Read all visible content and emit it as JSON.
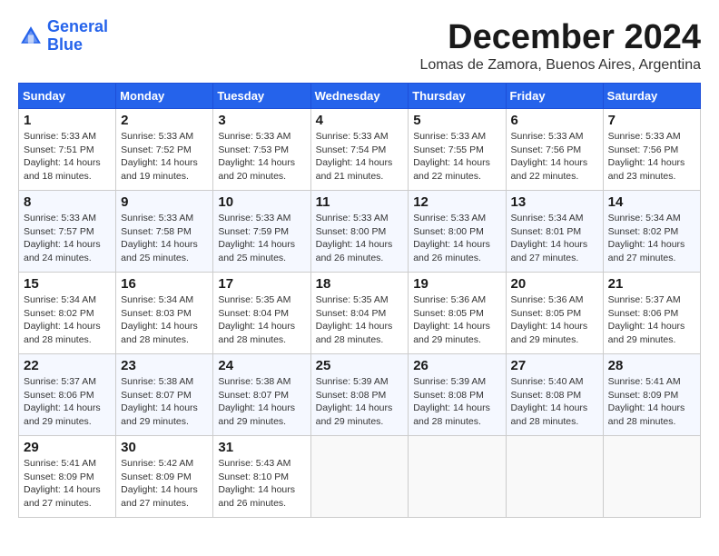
{
  "logo": {
    "line1": "General",
    "line2": "Blue"
  },
  "title": "December 2024",
  "subtitle": "Lomas de Zamora, Buenos Aires, Argentina",
  "days_of_week": [
    "Sunday",
    "Monday",
    "Tuesday",
    "Wednesday",
    "Thursday",
    "Friday",
    "Saturday"
  ],
  "weeks": [
    [
      {
        "day": "1",
        "sunrise": "Sunrise: 5:33 AM",
        "sunset": "Sunset: 7:51 PM",
        "daylight": "Daylight: 14 hours and 18 minutes."
      },
      {
        "day": "2",
        "sunrise": "Sunrise: 5:33 AM",
        "sunset": "Sunset: 7:52 PM",
        "daylight": "Daylight: 14 hours and 19 minutes."
      },
      {
        "day": "3",
        "sunrise": "Sunrise: 5:33 AM",
        "sunset": "Sunset: 7:53 PM",
        "daylight": "Daylight: 14 hours and 20 minutes."
      },
      {
        "day": "4",
        "sunrise": "Sunrise: 5:33 AM",
        "sunset": "Sunset: 7:54 PM",
        "daylight": "Daylight: 14 hours and 21 minutes."
      },
      {
        "day": "5",
        "sunrise": "Sunrise: 5:33 AM",
        "sunset": "Sunset: 7:55 PM",
        "daylight": "Daylight: 14 hours and 22 minutes."
      },
      {
        "day": "6",
        "sunrise": "Sunrise: 5:33 AM",
        "sunset": "Sunset: 7:56 PM",
        "daylight": "Daylight: 14 hours and 22 minutes."
      },
      {
        "day": "7",
        "sunrise": "Sunrise: 5:33 AM",
        "sunset": "Sunset: 7:56 PM",
        "daylight": "Daylight: 14 hours and 23 minutes."
      }
    ],
    [
      {
        "day": "8",
        "sunrise": "Sunrise: 5:33 AM",
        "sunset": "Sunset: 7:57 PM",
        "daylight": "Daylight: 14 hours and 24 minutes."
      },
      {
        "day": "9",
        "sunrise": "Sunrise: 5:33 AM",
        "sunset": "Sunset: 7:58 PM",
        "daylight": "Daylight: 14 hours and 25 minutes."
      },
      {
        "day": "10",
        "sunrise": "Sunrise: 5:33 AM",
        "sunset": "Sunset: 7:59 PM",
        "daylight": "Daylight: 14 hours and 25 minutes."
      },
      {
        "day": "11",
        "sunrise": "Sunrise: 5:33 AM",
        "sunset": "Sunset: 8:00 PM",
        "daylight": "Daylight: 14 hours and 26 minutes."
      },
      {
        "day": "12",
        "sunrise": "Sunrise: 5:33 AM",
        "sunset": "Sunset: 8:00 PM",
        "daylight": "Daylight: 14 hours and 26 minutes."
      },
      {
        "day": "13",
        "sunrise": "Sunrise: 5:34 AM",
        "sunset": "Sunset: 8:01 PM",
        "daylight": "Daylight: 14 hours and 27 minutes."
      },
      {
        "day": "14",
        "sunrise": "Sunrise: 5:34 AM",
        "sunset": "Sunset: 8:02 PM",
        "daylight": "Daylight: 14 hours and 27 minutes."
      }
    ],
    [
      {
        "day": "15",
        "sunrise": "Sunrise: 5:34 AM",
        "sunset": "Sunset: 8:02 PM",
        "daylight": "Daylight: 14 hours and 28 minutes."
      },
      {
        "day": "16",
        "sunrise": "Sunrise: 5:34 AM",
        "sunset": "Sunset: 8:03 PM",
        "daylight": "Daylight: 14 hours and 28 minutes."
      },
      {
        "day": "17",
        "sunrise": "Sunrise: 5:35 AM",
        "sunset": "Sunset: 8:04 PM",
        "daylight": "Daylight: 14 hours and 28 minutes."
      },
      {
        "day": "18",
        "sunrise": "Sunrise: 5:35 AM",
        "sunset": "Sunset: 8:04 PM",
        "daylight": "Daylight: 14 hours and 28 minutes."
      },
      {
        "day": "19",
        "sunrise": "Sunrise: 5:36 AM",
        "sunset": "Sunset: 8:05 PM",
        "daylight": "Daylight: 14 hours and 29 minutes."
      },
      {
        "day": "20",
        "sunrise": "Sunrise: 5:36 AM",
        "sunset": "Sunset: 8:05 PM",
        "daylight": "Daylight: 14 hours and 29 minutes."
      },
      {
        "day": "21",
        "sunrise": "Sunrise: 5:37 AM",
        "sunset": "Sunset: 8:06 PM",
        "daylight": "Daylight: 14 hours and 29 minutes."
      }
    ],
    [
      {
        "day": "22",
        "sunrise": "Sunrise: 5:37 AM",
        "sunset": "Sunset: 8:06 PM",
        "daylight": "Daylight: 14 hours and 29 minutes."
      },
      {
        "day": "23",
        "sunrise": "Sunrise: 5:38 AM",
        "sunset": "Sunset: 8:07 PM",
        "daylight": "Daylight: 14 hours and 29 minutes."
      },
      {
        "day": "24",
        "sunrise": "Sunrise: 5:38 AM",
        "sunset": "Sunset: 8:07 PM",
        "daylight": "Daylight: 14 hours and 29 minutes."
      },
      {
        "day": "25",
        "sunrise": "Sunrise: 5:39 AM",
        "sunset": "Sunset: 8:08 PM",
        "daylight": "Daylight: 14 hours and 29 minutes."
      },
      {
        "day": "26",
        "sunrise": "Sunrise: 5:39 AM",
        "sunset": "Sunset: 8:08 PM",
        "daylight": "Daylight: 14 hours and 28 minutes."
      },
      {
        "day": "27",
        "sunrise": "Sunrise: 5:40 AM",
        "sunset": "Sunset: 8:08 PM",
        "daylight": "Daylight: 14 hours and 28 minutes."
      },
      {
        "day": "28",
        "sunrise": "Sunrise: 5:41 AM",
        "sunset": "Sunset: 8:09 PM",
        "daylight": "Daylight: 14 hours and 28 minutes."
      }
    ],
    [
      {
        "day": "29",
        "sunrise": "Sunrise: 5:41 AM",
        "sunset": "Sunset: 8:09 PM",
        "daylight": "Daylight: 14 hours and 27 minutes."
      },
      {
        "day": "30",
        "sunrise": "Sunrise: 5:42 AM",
        "sunset": "Sunset: 8:09 PM",
        "daylight": "Daylight: 14 hours and 27 minutes."
      },
      {
        "day": "31",
        "sunrise": "Sunrise: 5:43 AM",
        "sunset": "Sunset: 8:10 PM",
        "daylight": "Daylight: 14 hours and 26 minutes."
      },
      null,
      null,
      null,
      null
    ]
  ]
}
